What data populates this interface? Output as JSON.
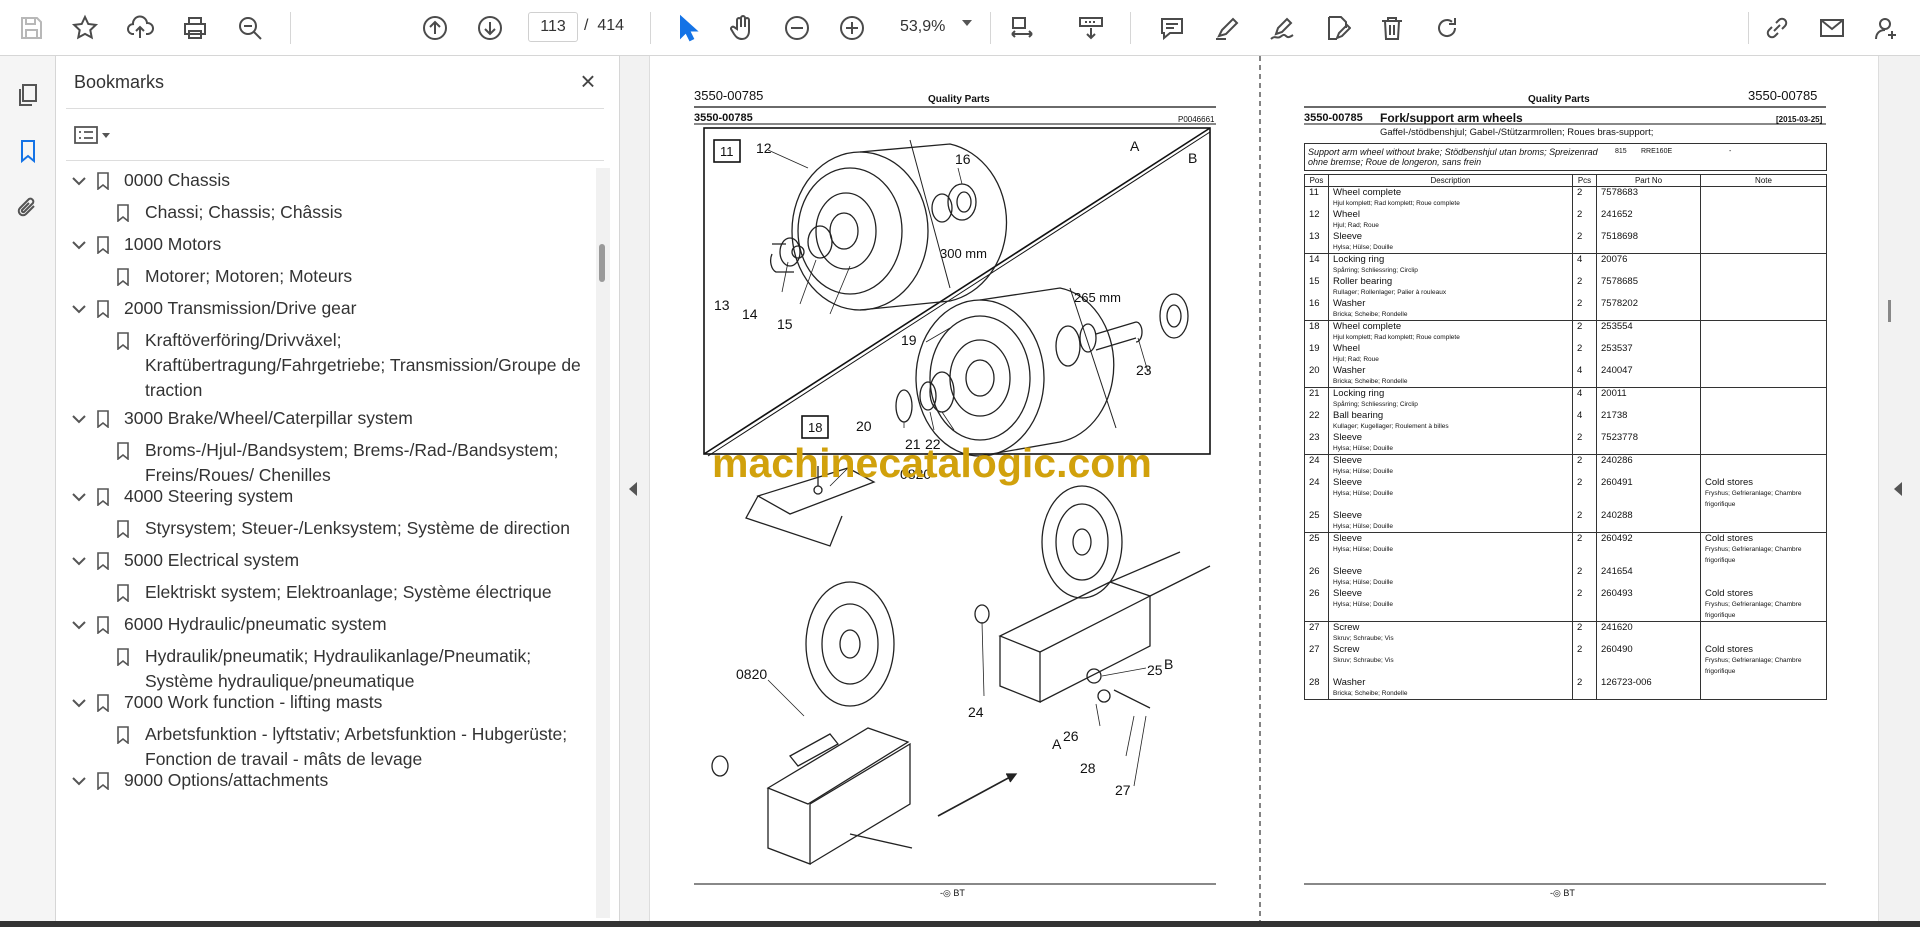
{
  "toolbar": {
    "page_current": "113",
    "page_total": "414",
    "page_sep": "/",
    "zoom": "53,9%",
    "icons": [
      "save-icon",
      "star-icon",
      "upload-cloud-icon",
      "print-icon",
      "zoom-search-icon",
      "page-up-icon",
      "page-down-icon",
      "select-pointer-icon",
      "hand-icon",
      "zoom-out-icon",
      "zoom-in-icon",
      "fit-page-icon",
      "scroll-mode-icon",
      "comment-icon",
      "highlight-pen-icon",
      "sign-icon",
      "edit-pdf-icon",
      "delete-icon",
      "rotate-icon",
      "share-link-icon",
      "email-icon",
      "account-icon"
    ]
  },
  "bookmarks": {
    "title": "Bookmarks",
    "close": "×",
    "items": [
      {
        "label": "0000 Chassis",
        "level": 0
      },
      {
        "label": "Chassi; Chassis; Châssis",
        "level": 1
      },
      {
        "label": "1000 Motors",
        "level": 0
      },
      {
        "label": "Motorer; Motoren; Moteurs",
        "level": 1
      },
      {
        "label": "2000 Transmission/Drive gear",
        "level": 0
      },
      {
        "label": "Kraftöverföring/Drivväxel; Kraftübertragung/Fahrgetriebe; Transmission/Groupe de traction",
        "level": 1
      },
      {
        "label": "3000 Brake/Wheel/Caterpillar system",
        "level": 0
      },
      {
        "label": "Broms-/Hjul-/Bandsystem; Brems-/Rad-/Bandsystem; Freins/Roues/ Chenilles",
        "level": 1
      },
      {
        "label": "4000 Steering system",
        "level": 0
      },
      {
        "label": "Styrsystem; Steuer-/Lenksystem; Système de direction",
        "level": 1
      },
      {
        "label": "5000 Electrical system",
        "level": 0
      },
      {
        "label": "Elektriskt system; Elektroanlage; Système électrique",
        "level": 1
      },
      {
        "label": "6000 Hydraulic/pneumatic system",
        "level": 0
      },
      {
        "label": "Hydraulik/pneumatik; Hydraulikanlage/Pneumatik; Système hydraulique/pneumatique",
        "level": 1
      },
      {
        "label": "7000 Work function - lifting masts",
        "level": 0
      },
      {
        "label": "Arbetsfunktion - lyftstativ; Arbetsfunktion - Hubgerüste; Fonction de travail - mâts de levage",
        "level": 1
      },
      {
        "label": "9000 Options/attachments",
        "level": 0
      }
    ]
  },
  "left_page": {
    "doc_no": "3550-00785",
    "center_title": "Quality Parts",
    "sub_doc_no": "3550-00785",
    "drawing_no": "P0046661",
    "callouts": [
      "11",
      "12",
      "13",
      "14",
      "15",
      "16",
      "18",
      "19",
      "20",
      "21",
      "22",
      "23",
      "24",
      "25",
      "26",
      "27",
      "28",
      "0820",
      "0820"
    ],
    "dims": [
      "300 mm",
      "265 mm"
    ],
    "letters": [
      "A",
      "B",
      "A",
      "B"
    ],
    "footer": "-◎ BT",
    "watermark": "machinecatalogic.com"
  },
  "right_page": {
    "center_title": "Quality Parts",
    "doc_no": "3550-00785",
    "sub_doc_no": "3550-00785",
    "title": "Fork/support arm wheels",
    "date": "[2015-03-25]",
    "subtitle": "Gaffel-/stödbenshjul; Gabel-/Stützarmrollen; Roues bras-support;",
    "info_text": "Support arm wheel without brake; Stödbenshjul utan broms; Spreizenrad ohne bremse; Roue de longeron, sans frein",
    "info_code1": "815",
    "info_code2": "RRE160E",
    "info_code3": "-",
    "headers": [
      "Pos",
      "Description",
      "Pcs",
      "Part No",
      "Note"
    ],
    "groups": [
      [
        {
          "pos": "11",
          "desc": "Wheel complete",
          "sub": "Hjul komplett; Rad komplett; Roue complete",
          "pcs": "2",
          "part": "7578683",
          "note": "",
          "nsub": ""
        },
        {
          "pos": "12",
          "desc": "Wheel",
          "sub": "Hjul; Rad; Roue",
          "pcs": "2",
          "part": "241652",
          "note": "",
          "nsub": ""
        },
        {
          "pos": "13",
          "desc": "Sleeve",
          "sub": "Hylsa; Hülse; Douille",
          "pcs": "2",
          "part": "7518698",
          "note": "",
          "nsub": ""
        }
      ],
      [
        {
          "pos": "14",
          "desc": "Locking ring",
          "sub": "Spårring; Schliessring; Circlip",
          "pcs": "4",
          "part": "20076",
          "note": "",
          "nsub": ""
        },
        {
          "pos": "15",
          "desc": "Roller bearing",
          "sub": "Rullager; Rollenlager; Palier à rouleaux",
          "pcs": "2",
          "part": "7578685",
          "note": "",
          "nsub": ""
        },
        {
          "pos": "16",
          "desc": "Washer",
          "sub": "Bricka; Scheibe; Rondelle",
          "pcs": "2",
          "part": "7578202",
          "note": "",
          "nsub": ""
        }
      ],
      [
        {
          "pos": "18",
          "desc": "Wheel complete",
          "sub": "Hjul komplett; Rad komplett; Roue complete",
          "pcs": "2",
          "part": "253554",
          "note": "",
          "nsub": ""
        },
        {
          "pos": "19",
          "desc": "Wheel",
          "sub": "Hjul; Rad; Roue",
          "pcs": "2",
          "part": "253537",
          "note": "",
          "nsub": ""
        },
        {
          "pos": "20",
          "desc": "Washer",
          "sub": "Bricka; Scheibe; Rondelle",
          "pcs": "4",
          "part": "240047",
          "note": "",
          "nsub": ""
        }
      ],
      [
        {
          "pos": "21",
          "desc": "Locking ring",
          "sub": "Spårring; Schliessring; Circlip",
          "pcs": "4",
          "part": "20011",
          "note": "",
          "nsub": ""
        },
        {
          "pos": "22",
          "desc": "Ball bearing",
          "sub": "Kullager; Kugellager; Roulement à billes",
          "pcs": "4",
          "part": "21738",
          "note": "",
          "nsub": ""
        },
        {
          "pos": "23",
          "desc": "Sleeve",
          "sub": "Hylsa; Hülse; Douille",
          "pcs": "2",
          "part": "7523778",
          "note": "",
          "nsub": ""
        }
      ],
      [
        {
          "pos": "24",
          "desc": "Sleeve",
          "sub": "Hylsa; Hülse; Douille",
          "pcs": "2",
          "part": "240286",
          "note": "",
          "nsub": ""
        },
        {
          "pos": "24",
          "desc": "Sleeve",
          "sub": "Hylsa; Hülse; Douille",
          "pcs": "2",
          "part": "260491",
          "note": "Cold stores",
          "nsub": "Fryshus; Gefrieranlage; Chambre frigorifique"
        },
        {
          "pos": "25",
          "desc": "Sleeve",
          "sub": "Hylsa; Hülse; Douille",
          "pcs": "2",
          "part": "240288",
          "note": "",
          "nsub": ""
        }
      ],
      [
        {
          "pos": "25",
          "desc": "Sleeve",
          "sub": "Hylsa; Hülse; Douille",
          "pcs": "2",
          "part": "260492",
          "note": "Cold stores",
          "nsub": "Fryshus; Gefrieranlage; Chambre frigorifique"
        },
        {
          "pos": "26",
          "desc": "Sleeve",
          "sub": "Hylsa; Hülse; Douille",
          "pcs": "2",
          "part": "241654",
          "note": "",
          "nsub": ""
        },
        {
          "pos": "26",
          "desc": "Sleeve",
          "sub": "Hylsa; Hülse; Douille",
          "pcs": "2",
          "part": "260493",
          "note": "Cold stores",
          "nsub": "Fryshus; Gefrieranlage; Chambre frigorifique"
        }
      ],
      [
        {
          "pos": "27",
          "desc": "Screw",
          "sub": "Skruv; Schraube; Vis",
          "pcs": "2",
          "part": "241620",
          "note": "",
          "nsub": ""
        },
        {
          "pos": "27",
          "desc": "Screw",
          "sub": "Skruv; Schraube; Vis",
          "pcs": "2",
          "part": "260490",
          "note": "Cold stores",
          "nsub": "Fryshus; Gefrieranlage; Chambre frigorifique"
        },
        {
          "pos": "28",
          "desc": "Washer",
          "sub": "Bricka; Scheibe; Rondelle",
          "pcs": "2",
          "part": "126723-006",
          "note": "",
          "nsub": ""
        }
      ]
    ],
    "footer": "-◎ BT"
  }
}
